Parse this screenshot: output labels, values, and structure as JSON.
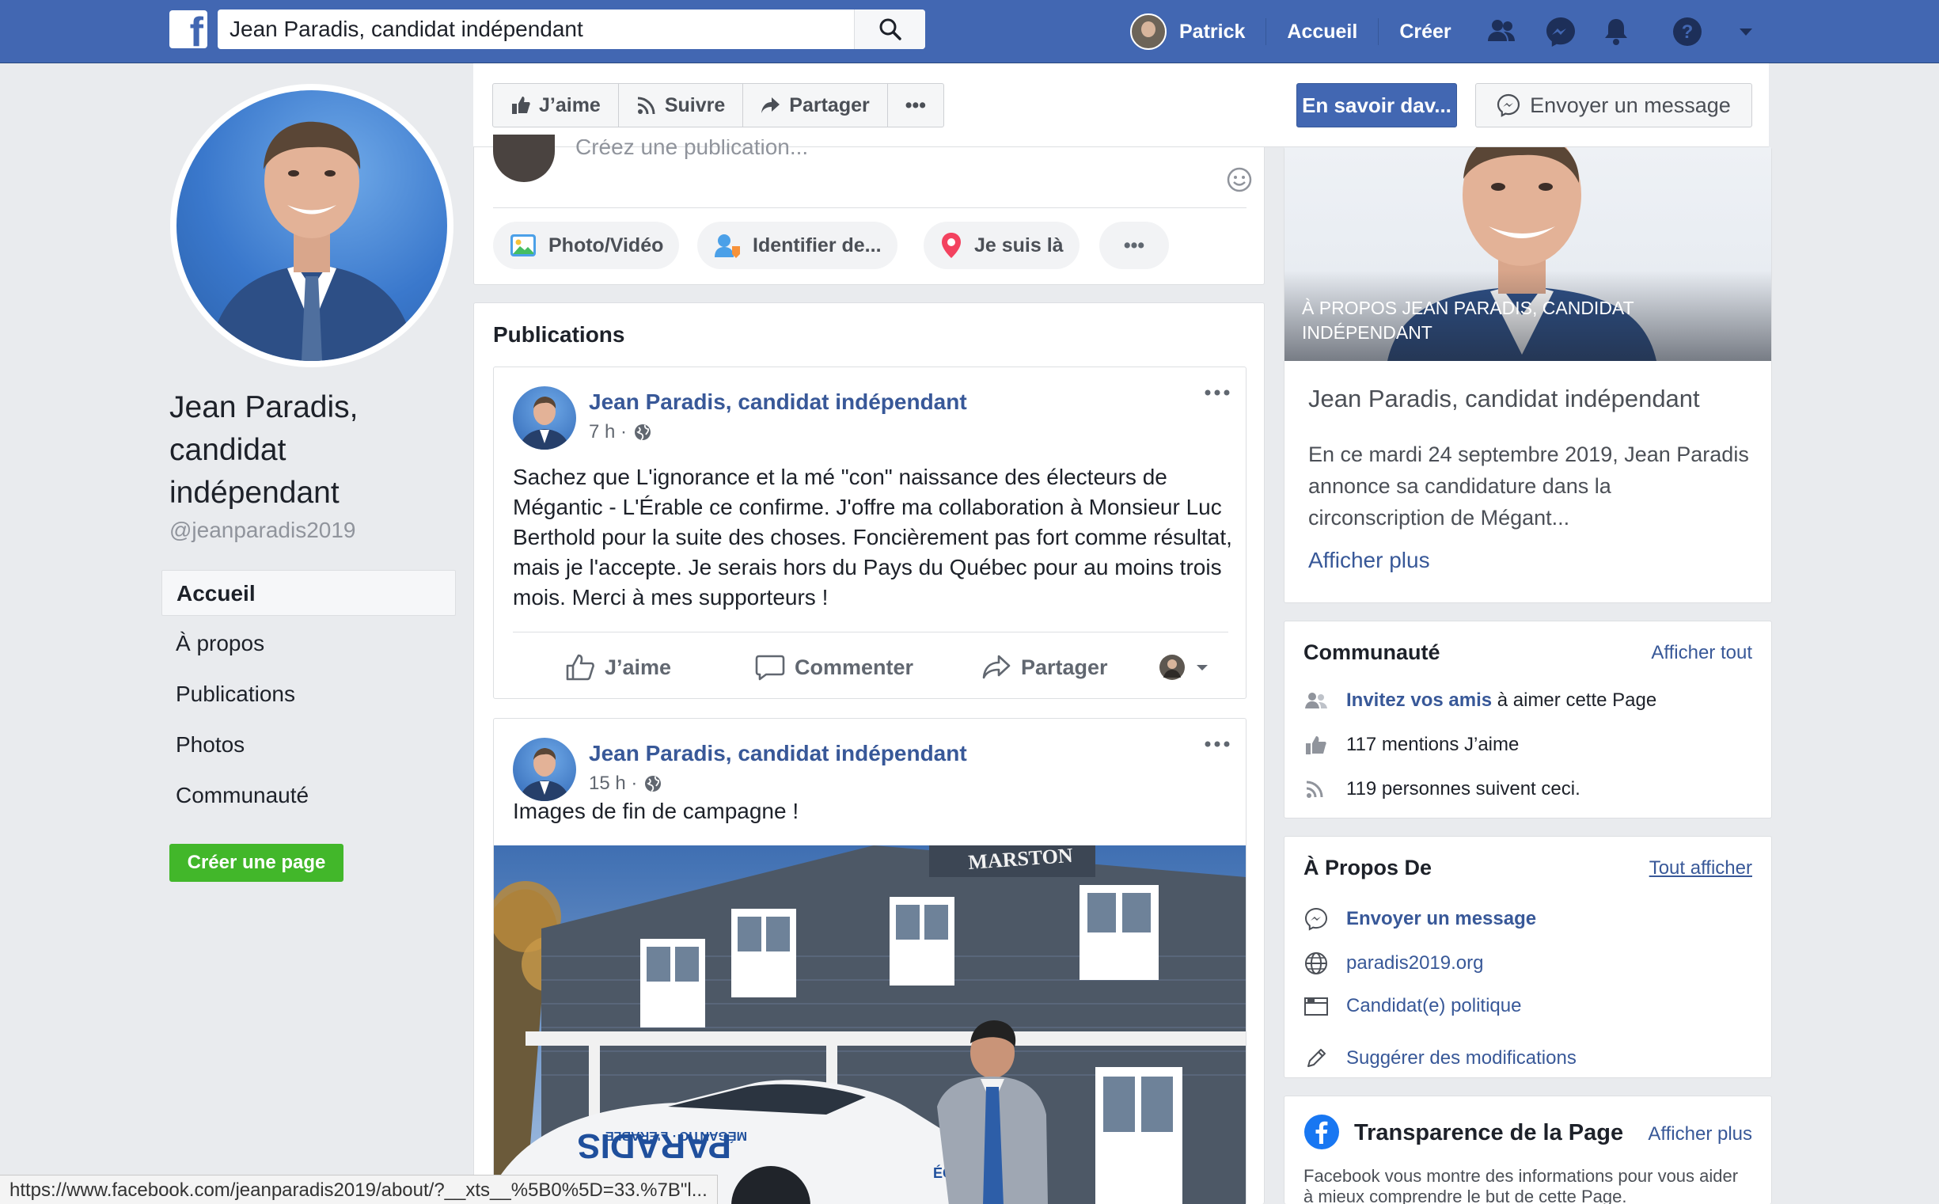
{
  "topbar": {
    "search_value": "Jean Paradis, candidat indépendant",
    "user_name": "Patrick",
    "home_label": "Accueil",
    "create_label": "Créer"
  },
  "left": {
    "page_name": "Jean Paradis, candidat indépendant",
    "handle": "@jeanparadis2019",
    "nav": [
      {
        "label": "Accueil",
        "active": true
      },
      {
        "label": "À propos"
      },
      {
        "label": "Publications"
      },
      {
        "label": "Photos"
      },
      {
        "label": "Communauté"
      }
    ],
    "create_page_label": "Créer une page"
  },
  "action_bar": {
    "like": "J’aime",
    "follow": "Suivre",
    "share": "Partager",
    "more": "•••",
    "learn_more": "En savoir dav...",
    "send_message": "Envoyer un message"
  },
  "composer": {
    "placeholder": "Créez une publication...",
    "photo_video": "Photo/Vidéo",
    "tag": "Identifier de...",
    "checkin": "Je suis là",
    "more": "•••"
  },
  "publications": {
    "title": "Publications",
    "posts": [
      {
        "author": "Jean Paradis, candidat indépendant",
        "time": "7 h ·",
        "text": "Sachez que L'ignorance et la mé \"con\" naissance des électeurs de Mégantic - L'Érable ce confirme. J'offre ma collaboration à Monsieur Luc Berthold pour la suite des choses. Foncièrement pas fort comme résultat, mais je l'accepte. Je serais hors du Pays du Québec pour au moins trois mois. Merci à mes supporteurs !",
        "actions": {
          "like": "J’aime",
          "comment": "Commenter",
          "share": "Partager"
        }
      },
      {
        "author": "Jean Paradis, candidat indépendant",
        "time": "15 h ·",
        "text": "Images de fin de campagne !",
        "image_sign": "MARSTON",
        "car_text": "PARADIS",
        "car_subtext": "MÉGANTIC · L'ÉRABLE",
        "car_door_text": "ÉCOUTER"
      }
    ]
  },
  "about": {
    "hero_caption": "À PROPOS JEAN PARADIS, CANDIDAT INDÉPENDANT",
    "name": "Jean Paradis, candidat indépendant",
    "description": "En ce mardi 24 septembre 2019, Jean Paradis annonce sa candidature dans la circonscription de Mégant...",
    "more": "Afficher plus"
  },
  "community": {
    "title": "Communauté",
    "see_all": "Afficher tout",
    "invite_strong": "Invitez vos amis",
    "invite_rest": " à aimer cette Page",
    "likes": "117 mentions J’aime",
    "followers": "119 personnes suivent ceci."
  },
  "apropos": {
    "title": "À Propos De",
    "see_all": "Tout afficher",
    "message": "Envoyer un message",
    "website": "paradis2019.org",
    "category": "Candidat(e) politique",
    "suggest": "Suggérer des modifications"
  },
  "transparency": {
    "title": "Transparence de la Page",
    "more": "Afficher plus",
    "text": "Facebook vous montre des informations pour vous aider à mieux comprendre le but de cette Page."
  },
  "status_url": "https://www.facebook.com/jeanparadis2019/about/?__xts__%5B0%5D=33.%7B\"l...",
  "colors": {
    "brand": "#4267b2",
    "link": "#385898",
    "green": "#42b72a",
    "background": "#e9ebee"
  }
}
